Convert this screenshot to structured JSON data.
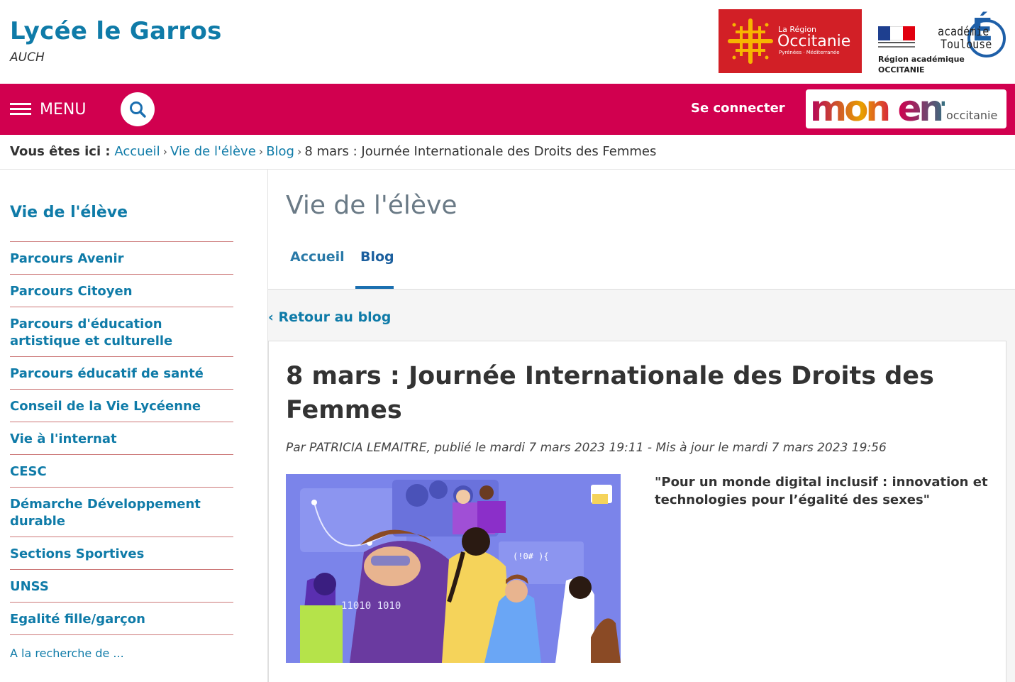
{
  "header": {
    "site_title": "Lycée le Garros",
    "site_city": "AUCH",
    "logo_region": {
      "small": "La Région",
      "big": "Occitanie",
      "sub": "Pyrénées · Méditerranée",
      "color": "#d21f26"
    },
    "logo_state": {
      "line1": "Région académique",
      "line2": "OCCITANIE"
    },
    "logo_academy": {
      "line1": "académie",
      "line2": "Toulouse",
      "letter": "É"
    }
  },
  "navbar": {
    "menu_label": "MENU",
    "login_label": "Se connecter",
    "ent_logo": {
      "word": "mon ent",
      "sub": "occitanie"
    },
    "color": "#d1004f"
  },
  "breadcrumb": {
    "lead": "Vous êtes ici :",
    "items": [
      "Accueil",
      "Vie de l'élève",
      "Blog"
    ],
    "current": "8 mars : Journée Internationale des Droits des Femmes"
  },
  "sidebar": {
    "title": "Vie de l'élève",
    "items": [
      "Parcours Avenir",
      "Parcours Citoyen",
      "Parcours d'éducation artistique et culturelle",
      "Parcours éducatif de santé",
      "Conseil de la Vie Lycéenne",
      "Vie à l'internat",
      "CESC",
      "Démarche Développement durable",
      "Sections Sportives",
      "UNSS",
      "Egalité fille/garçon",
      "A la recherche de ..."
    ]
  },
  "main": {
    "section_title": "Vie de l'élève",
    "tabs": [
      {
        "label": "Accueil",
        "active": false
      },
      {
        "label": "Blog",
        "active": true
      }
    ],
    "back_label": "‹ Retour au blog",
    "article": {
      "title": "8 mars : Journée Internationale des Droits des Femmes",
      "meta": "Par PATRICIA LEMAITRE, publié le mardi 7 mars 2023 19:11 - Mis à jour le mardi 7 mars 2023 19:56",
      "quote": "\"Pour un monde digital inclusif : innovation et technologies pour l’égalité des sexes\"",
      "image_code": "11010 1010",
      "image_code2": "(!0# ){"
    }
  },
  "colors": {
    "brand_blue": "#0f7ba8",
    "nav_pink": "#d1004f",
    "tab_underline": "#1b6fb0"
  }
}
